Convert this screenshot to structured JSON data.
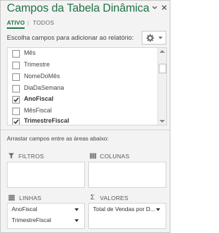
{
  "pane": {
    "title": "Campos da Tabela Dinâmica",
    "tabs": [
      {
        "label": "ATIVO"
      },
      {
        "label": "TODOS"
      }
    ],
    "instruction": "Escolha campos para adicionar ao relatório:",
    "fields": [
      {
        "label": "Mês",
        "checked": false
      },
      {
        "label": "Trimestre",
        "checked": false
      },
      {
        "label": "NomeDoMês",
        "checked": false
      },
      {
        "label": "DiaDaSemana",
        "checked": false
      },
      {
        "label": "AnoFiscal",
        "checked": true
      },
      {
        "label": "MêsFiscal",
        "checked": false
      },
      {
        "label": "TrimestreFiscal",
        "checked": true
      }
    ],
    "drag_instruction": "Arrastar campos entre as áreas abaixo:",
    "areas": {
      "filters": {
        "label": "FILTROS",
        "items": []
      },
      "columns": {
        "label": "COLUNAS",
        "items": []
      },
      "rows": {
        "label": "LINHAS",
        "items": [
          "AnoFiscal",
          "TrimestreFiscal"
        ]
      },
      "values": {
        "label": "VALORES",
        "items": [
          "Total de Vendas por D..."
        ]
      }
    }
  },
  "colors": {
    "accent": "#217346",
    "pane_bg": "#f3f3f3"
  }
}
